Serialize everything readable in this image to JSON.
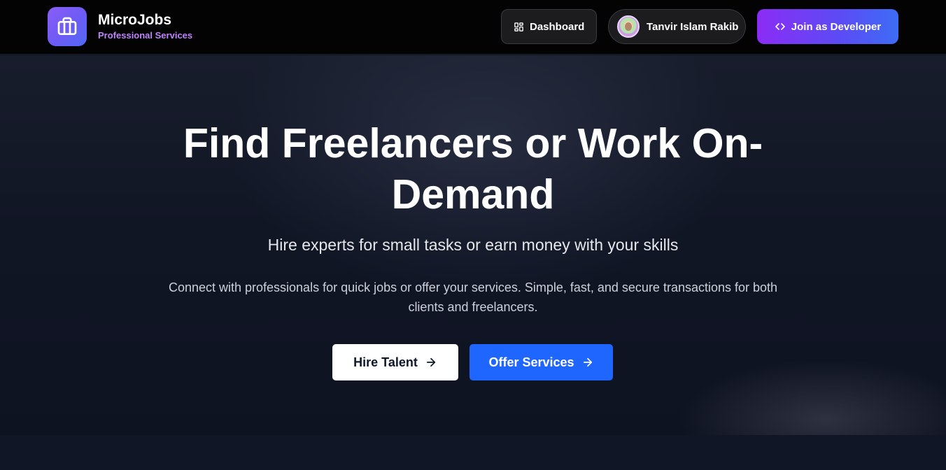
{
  "brand": {
    "name": "MicroJobs",
    "tagline": "Professional Services",
    "logo_icon": "briefcase-icon"
  },
  "nav": {
    "dashboard_label": "Dashboard",
    "dashboard_icon": "grid-icon",
    "user_name": "Tanvir Islam Rakib",
    "join_label": "Join as Developer",
    "join_icon": "code-icon"
  },
  "hero": {
    "title": "Find Freelancers or Work On-Demand",
    "subtitle": "Hire experts for small tasks or earn money with your skills",
    "description": "Connect with professionals for quick jobs or offer your services. Simple, fast, and secure transactions for both clients and freelancers.",
    "hire_label": "Hire Talent",
    "offer_label": "Offer Services"
  },
  "colors": {
    "accent_purple": "#8b5cf6",
    "brand_tagline": "#c084fc",
    "primary_blue": "#1f66ff",
    "background": "#0f1424"
  }
}
